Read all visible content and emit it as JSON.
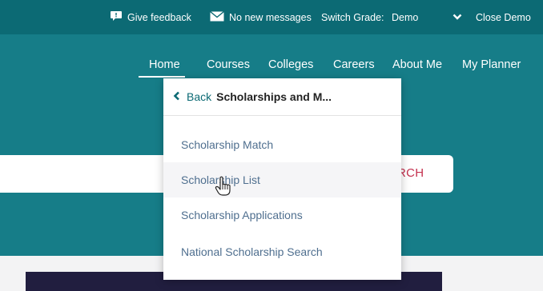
{
  "topbar": {
    "feedback_label": "Give feedback",
    "messages_label": "No new messages",
    "switch_grade_label": "Switch Grade:",
    "grade_value": "Demo",
    "close_demo_label": "Close Demo"
  },
  "nav": {
    "items": [
      {
        "label": "Home"
      },
      {
        "label": "Courses"
      },
      {
        "label": "Colleges"
      },
      {
        "label": "Careers"
      },
      {
        "label": "About Me"
      },
      {
        "label": "My Planner"
      }
    ]
  },
  "search": {
    "button_label": "RCH"
  },
  "dropdown": {
    "back_label": "Back",
    "title": "Scholarships and M...",
    "items": [
      {
        "label": "Scholarship Match"
      },
      {
        "label": "Scholarship List"
      },
      {
        "label": "Scholarship Applications"
      },
      {
        "label": "National Scholarship Search"
      }
    ]
  },
  "colors": {
    "topbar": "#0c6a74",
    "hero": "#167d88",
    "search_accent": "#c4304e",
    "dropdown_link": "#4f6f8f"
  },
  "icons": [
    "feedback-icon",
    "mail-icon",
    "chevron-down-icon",
    "chevron-left-icon",
    "hand-cursor-icon"
  ]
}
